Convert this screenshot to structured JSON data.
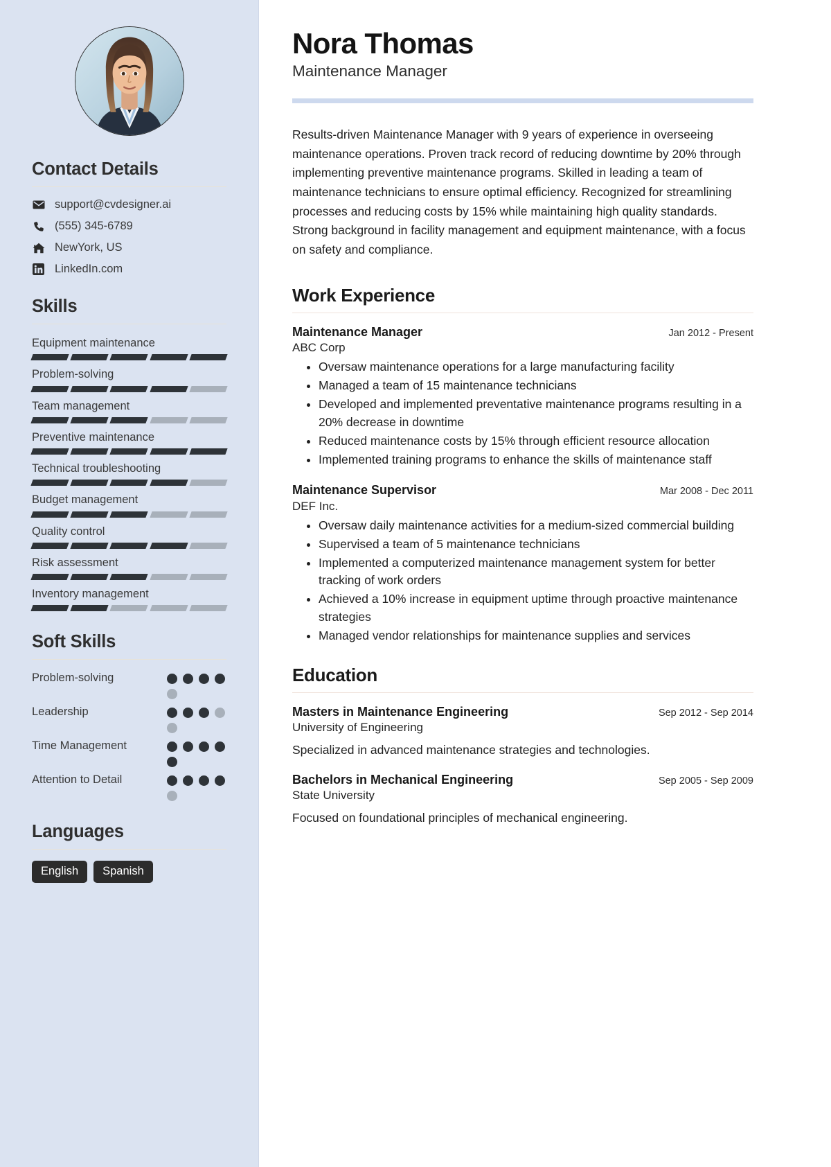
{
  "accent": {
    "sidebar_bg": "#dbe3f1",
    "header_bar": "#cdd9ee",
    "rule": "#f0e2da",
    "dark": "#2e3338",
    "muted": "#a8b0ba",
    "pill_bg": "#2c2c2c"
  },
  "header": {
    "name": "Nora Thomas",
    "job_title": "Maintenance Manager"
  },
  "summary": {
    "text": "Results-driven Maintenance Manager with 9 years of experience in overseeing maintenance operations. Proven track record of reducing downtime by 20% through implementing preventive maintenance programs. Skilled in leading a team of maintenance technicians to ensure optimal efficiency. Recognized for streamlining processes and reducing costs by 15% while maintaining high quality standards. Strong background in facility management and equipment maintenance, with a focus on safety and compliance."
  },
  "sidebar": {
    "contact": {
      "heading": "Contact Details",
      "items": [
        {
          "icon": "envelope-icon",
          "label": "support@cvdesigner.ai"
        },
        {
          "icon": "phone-icon",
          "label": "(555) 345-6789"
        },
        {
          "icon": "home-icon",
          "label": "NewYork, US"
        },
        {
          "icon": "linkedin-icon",
          "label": "LinkedIn.com"
        }
      ]
    },
    "skills": {
      "heading": "Skills",
      "max": 5,
      "items": [
        {
          "label": "Equipment maintenance",
          "level": 5
        },
        {
          "label": "Problem-solving",
          "level": 4
        },
        {
          "label": "Team management",
          "level": 3
        },
        {
          "label": "Preventive maintenance",
          "level": 5
        },
        {
          "label": "Technical troubleshooting",
          "level": 4
        },
        {
          "label": "Budget management",
          "level": 3
        },
        {
          "label": "Quality control",
          "level": 4
        },
        {
          "label": "Risk assessment",
          "level": 3
        },
        {
          "label": "Inventory management",
          "level": 2
        }
      ]
    },
    "soft_skills": {
      "heading": "Soft Skills",
      "max": 5,
      "items": [
        {
          "label": "Problem-solving",
          "level": 4
        },
        {
          "label": "Leadership",
          "level": 3
        },
        {
          "label": "Time Management",
          "level": 5
        },
        {
          "label": "Attention to Detail",
          "level": 4
        }
      ]
    },
    "languages": {
      "heading": "Languages",
      "items": [
        "English",
        "Spanish"
      ]
    }
  },
  "work_experience": {
    "heading": "Work Experience",
    "entries": [
      {
        "title": "Maintenance Manager",
        "org": "ABC Corp",
        "date": "Jan 2012 - Present",
        "bullets": [
          "Oversaw maintenance operations for a large manufacturing facility",
          "Managed a team of 15 maintenance technicians",
          "Developed and implemented preventative maintenance programs resulting in a 20% decrease in downtime",
          "Reduced maintenance costs by 15% through efficient resource allocation",
          "Implemented training programs to enhance the skills of maintenance staff"
        ]
      },
      {
        "title": "Maintenance Supervisor",
        "org": "DEF Inc.",
        "date": "Mar 2008 - Dec 2011",
        "bullets": [
          "Oversaw daily maintenance activities for a medium-sized commercial building",
          "Supervised a team of 5 maintenance technicians",
          "Implemented a computerized maintenance management system for better tracking of work orders",
          "Achieved a 10% increase in equipment uptime through proactive maintenance strategies",
          "Managed vendor relationships for maintenance supplies and services"
        ]
      }
    ]
  },
  "education": {
    "heading": "Education",
    "entries": [
      {
        "title": "Masters in Maintenance Engineering",
        "org": "University of Engineering",
        "date": "Sep 2012 - Sep 2014",
        "desc": "Specialized in advanced maintenance strategies and technologies."
      },
      {
        "title": "Bachelors in Mechanical Engineering",
        "org": "State University",
        "date": "Sep 2005 - Sep 2009",
        "desc": "Focused on foundational principles of mechanical engineering."
      }
    ]
  }
}
